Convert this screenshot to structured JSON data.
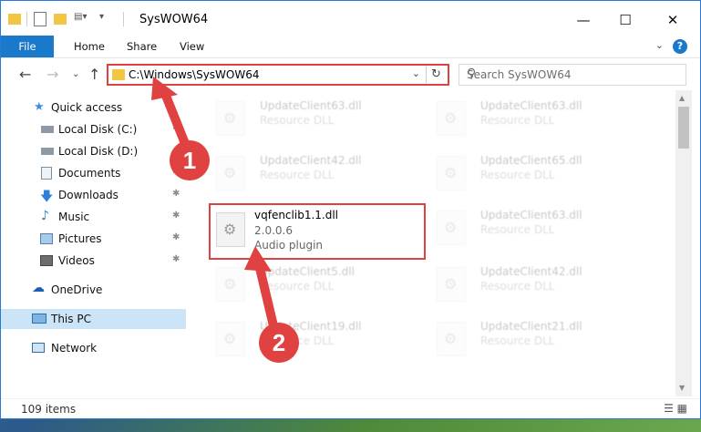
{
  "window": {
    "title": "SysWOW64"
  },
  "ribbon": {
    "tabs": [
      "File",
      "Home",
      "Share",
      "View"
    ],
    "help": "?"
  },
  "nav": {
    "address": "C:\\Windows\\SysWOW64",
    "search_placeholder": "Search SysWOW64"
  },
  "sidebar": {
    "items": [
      {
        "label": "Quick access",
        "icon": "star-icon"
      },
      {
        "label": "Local Disk (C:)",
        "icon": "drive-icon"
      },
      {
        "label": "Local Disk (D:)",
        "icon": "drive-icon"
      },
      {
        "label": "Documents",
        "icon": "documents-icon"
      },
      {
        "label": "Downloads",
        "icon": "download-icon"
      },
      {
        "label": "Music",
        "icon": "music-icon"
      },
      {
        "label": "Pictures",
        "icon": "pictures-icon"
      },
      {
        "label": "Videos",
        "icon": "videos-icon"
      },
      {
        "label": "OneDrive",
        "icon": "cloud-icon"
      },
      {
        "label": "This PC",
        "icon": "computer-icon"
      },
      {
        "label": "Network",
        "icon": "network-icon"
      }
    ]
  },
  "files": [
    {
      "name": "UpdateClient63.dll",
      "desc": "Resource DLL"
    },
    {
      "name": "UpdateClient63.dll",
      "desc": "Resource DLL"
    },
    {
      "name": "UpdateClient42.dll",
      "desc": "Resource DLL"
    },
    {
      "name": "UpdateClient65.dll",
      "desc": "Resource DLL"
    },
    {
      "name": "vqfenclib1.1.dll",
      "version": "2.0.0.6",
      "desc": "Audio plugin"
    },
    {
      "name": "UpdateClient63.dll",
      "desc": "Resource DLL"
    },
    {
      "name": "UpdateClient5.dll",
      "desc": "Resource DLL"
    },
    {
      "name": "UpdateClient42.dll",
      "desc": "Resource DLL"
    },
    {
      "name": "UpdateClient19.dll",
      "desc": "Resource DLL"
    },
    {
      "name": "UpdateClient21.dll",
      "desc": "Resource DLL"
    }
  ],
  "status": {
    "count": "109 items"
  },
  "annotations": {
    "step1": "1",
    "step2": "2"
  },
  "colors": {
    "accent": "#1979ca",
    "highlight": "#e04141"
  }
}
